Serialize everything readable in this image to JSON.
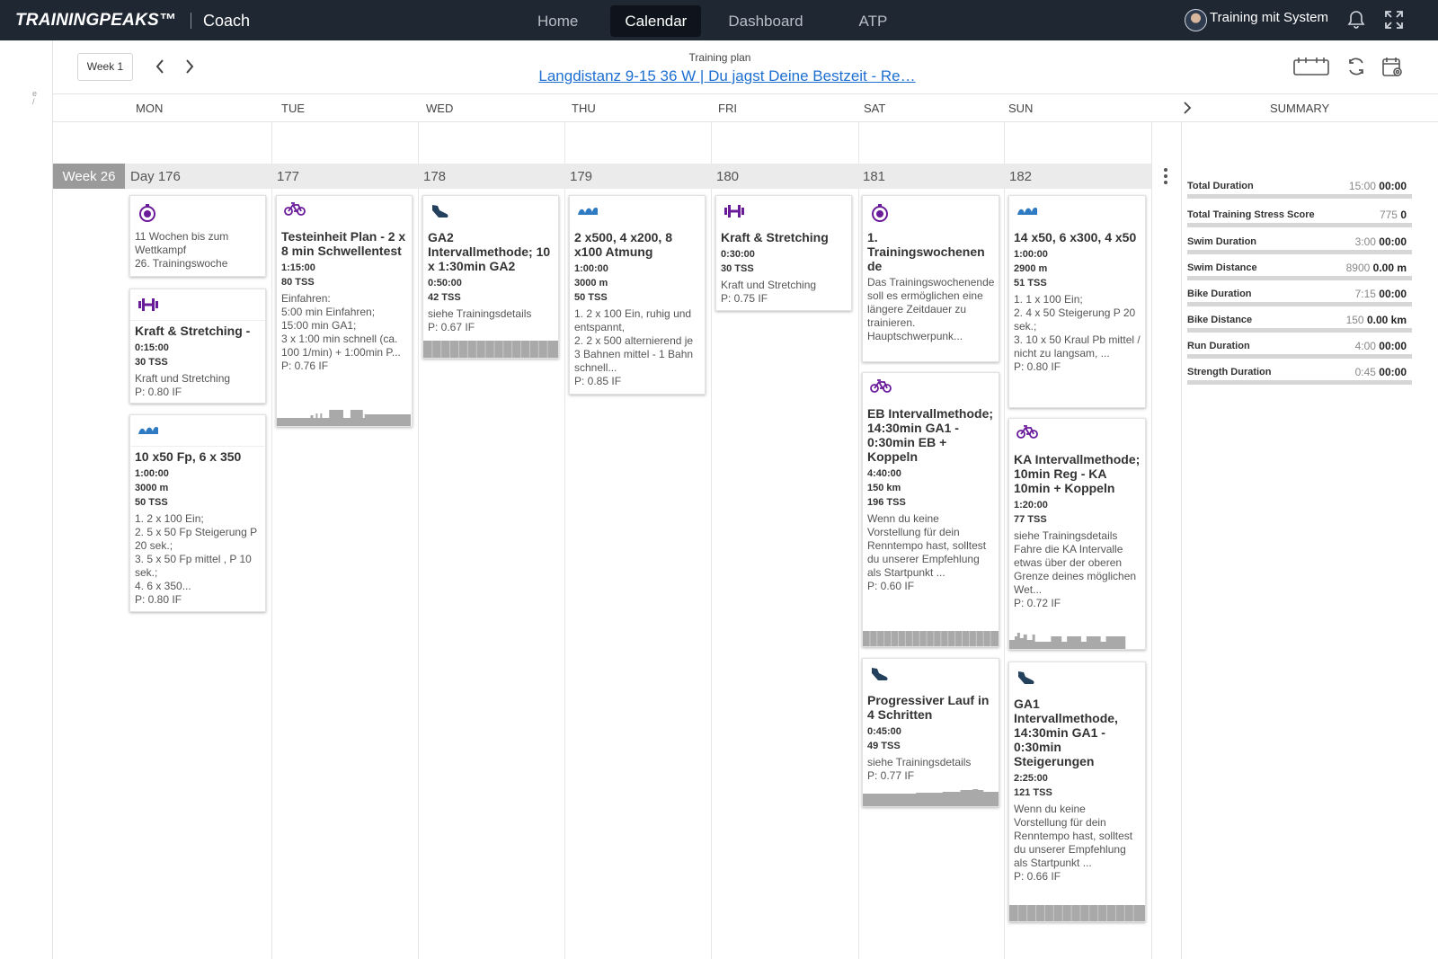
{
  "topbar": {
    "logo": "TRAININGPEAKS™",
    "product": "Coach",
    "nav": [
      "Home",
      "Calendar",
      "Dashboard",
      "ATP"
    ],
    "active_nav": "Calendar",
    "user_name": "Training mit System"
  },
  "toolbar": {
    "week_button": "Week 1",
    "plan_caption": "Training plan",
    "plan_title": "Langdistanz 9-15 36 W | Du jagst Deine Bestzeit - Re…"
  },
  "days": [
    "MON",
    "TUE",
    "WED",
    "THU",
    "FRI",
    "SAT",
    "SUN"
  ],
  "summary_header": "SUMMARY",
  "week": {
    "label": "Week 26",
    "day_numbers": [
      "Day 176",
      "177",
      "178",
      "179",
      "180",
      "181",
      "182"
    ]
  },
  "summary": [
    {
      "label": "Total Duration",
      "planned": "15:00",
      "completed": "00:00"
    },
    {
      "label": "Total Training Stress Score",
      "planned": "775",
      "completed": "0"
    },
    {
      "label": "Swim Duration",
      "planned": "3:00",
      "completed": "00:00"
    },
    {
      "label": "Swim Distance",
      "planned": "8900",
      "completed": "0.00 m"
    },
    {
      "label": "Bike Duration",
      "planned": "7:15",
      "completed": "00:00"
    },
    {
      "label": "Bike Distance",
      "planned": "150",
      "completed": "0.00 km"
    },
    {
      "label": "Run Duration",
      "planned": "4:00",
      "completed": "00:00"
    },
    {
      "label": "Strength Duration",
      "planned": "0:45",
      "completed": "00:00"
    }
  ],
  "colors": {
    "topbar": "#1f2733",
    "purple": "#6a1b9a",
    "swim_blue": "#2e7bc4",
    "run_navy": "#23405c",
    "link": "#1d6fd1"
  },
  "cards": {
    "mon_event": {
      "icon": "stopwatch-icon",
      "lines": [
        "11 Wochen bis zum Wettkampf",
        "26. Trainingswoche"
      ]
    },
    "mon_strength": {
      "icon": "dumbbell-icon",
      "title": "Kraft & Stretching -",
      "duration": "0:15:00",
      "tss": "30 TSS",
      "desc": "Kraft und Stretching",
      "if": "P: 0.80 IF"
    },
    "mon_swim": {
      "icon": "swim-icon",
      "title": "10 x50 Fp, 6 x 350",
      "duration": "1:00:00",
      "distance": "3000 m",
      "tss": "50 TSS",
      "desc": "1. 2 x 100 Ein;\n2. 5 x 50 Fp Steigerung P 20 sek.;\n3. 5 x 50 Fp mittel , P 10 sek.;\n4. 6 x 350...",
      "if": "P: 0.80 IF"
    },
    "tue_bike": {
      "icon": "bike-icon",
      "title": "Testeinheit Plan - 2 x 8 min Schwellentest",
      "duration": "1:15:00",
      "tss": "80 TSS",
      "desc": "Einfahren:\n5:00 min Einfahren;\n15:00 min GA1;\n3 x 1:00 min schnell (ca. 100 1/min) + 1:00min P...",
      "if": "P: 0.76 IF"
    },
    "wed_run": {
      "icon": "run-shoe-icon",
      "title": "GA2 Intervallmethode; 10 x 1:30min GA2",
      "duration": "0:50:00",
      "tss": "42 TSS",
      "desc": "siehe Trainingsdetails",
      "if": "P: 0.67 IF"
    },
    "thu_swim": {
      "icon": "swim-icon",
      "title": "2 x500, 4 x200, 8 x100 Atmung",
      "duration": "1:00:00",
      "distance": "3000 m",
      "tss": "50 TSS",
      "desc": "1. 2 x 100 Ein, ruhig und entspannt,\n2. 2 x 500 alternierend je 3 Bahnen mittel - 1 Bahn schnell...",
      "if": "P: 0.85 IF"
    },
    "fri_strength": {
      "icon": "dumbbell-icon",
      "title": "Kraft & Stretching",
      "duration": "0:30:00",
      "tss": "30 TSS",
      "desc": "Kraft und Stretching",
      "if": "P: 0.75 IF"
    },
    "sat_event": {
      "icon": "stopwatch-icon",
      "title": "1. Trainingswochenen de",
      "desc": "Das Trainingswochenende soll es ermöglichen eine längere Zeitdauer zu trainieren. Hauptschwerpunk..."
    },
    "sat_bike": {
      "icon": "bike-icon",
      "title": "EB Intervallmethode; 14:30min GA1 - 0:30min EB + Koppeln",
      "duration": "4:40:00",
      "distance": "150 km",
      "tss": "196 TSS",
      "desc": "Wenn du keine Vorstellung für dein Renntempo hast, solltest du unserer Empfehlung als Startpunkt ...",
      "if": "P: 0.60 IF"
    },
    "sat_run": {
      "icon": "run-shoe-icon",
      "title": "Progressiver Lauf in 4 Schritten",
      "duration": "0:45:00",
      "tss": "49 TSS",
      "desc": "siehe Trainingsdetails",
      "if": "P: 0.77 IF"
    },
    "sun_swim": {
      "icon": "swim-icon",
      "title": "14 x50, 6 x300, 4 x50",
      "duration": "1:00:00",
      "distance": "2900 m",
      "tss": "51 TSS",
      "desc": "1. 1 x 100 Ein;\n2. 4 x 50 Steigerung P 20 sek.;\n3. 10 x 50 Kraul Pb mittel / nicht zu langsam, ...",
      "if": "P: 0.80 IF"
    },
    "sun_bike": {
      "icon": "bike-icon",
      "title": "KA Intervallmethode; 10min Reg - KA 10min + Koppeln",
      "duration": "1:20:00",
      "tss": "77 TSS",
      "desc": "siehe Trainingsdetails\nFahre die KA Intervalle etwas über der oberen Grenze deines möglichen Wet...",
      "if": "P: 0.72 IF"
    },
    "sun_run": {
      "icon": "run-shoe-icon",
      "title": "GA1 Intervallmethode, 14:30min GA1 - 0:30min Steigerungen",
      "duration": "2:25:00",
      "tss": "121 TSS",
      "desc": "Wenn du keine Vorstellung für dein Renntempo hast, solltest du unserer Empfehlung als Startpunkt ...",
      "if": "P: 0.66 IF"
    }
  }
}
